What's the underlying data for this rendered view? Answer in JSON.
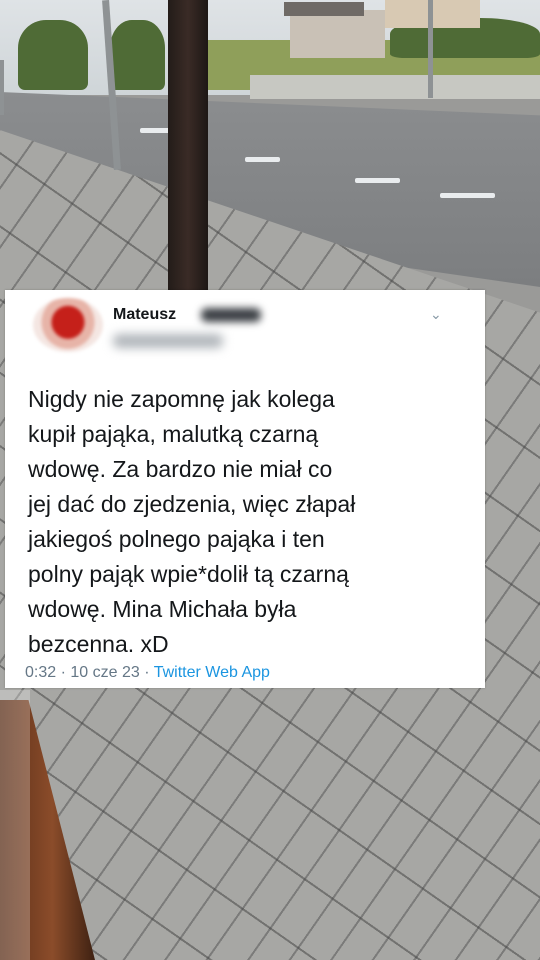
{
  "tweet": {
    "author_name": "Mateusz",
    "text_lines": [
      "Nigdy nie zapomnę jak kolega",
      "kupił pająka, malutką czarną",
      "wdowę. Za bardzo nie miał co",
      "jej dać do zjedzenia, więc złapał",
      "jakiegoś polnego pająka i ten",
      "polny pająk wpie*dolił tą czarną",
      "wdowę. Mina Michała była",
      "bezcenna. xD"
    ],
    "time": "0:32",
    "date": "10 cze 23",
    "separator": "·",
    "source": "Twitter Web App",
    "menu_icon": "chevron-down-icon"
  },
  "colors": {
    "text": "#14171a",
    "meta": "#657786",
    "link": "#1b95e0",
    "card": "#ffffff"
  }
}
